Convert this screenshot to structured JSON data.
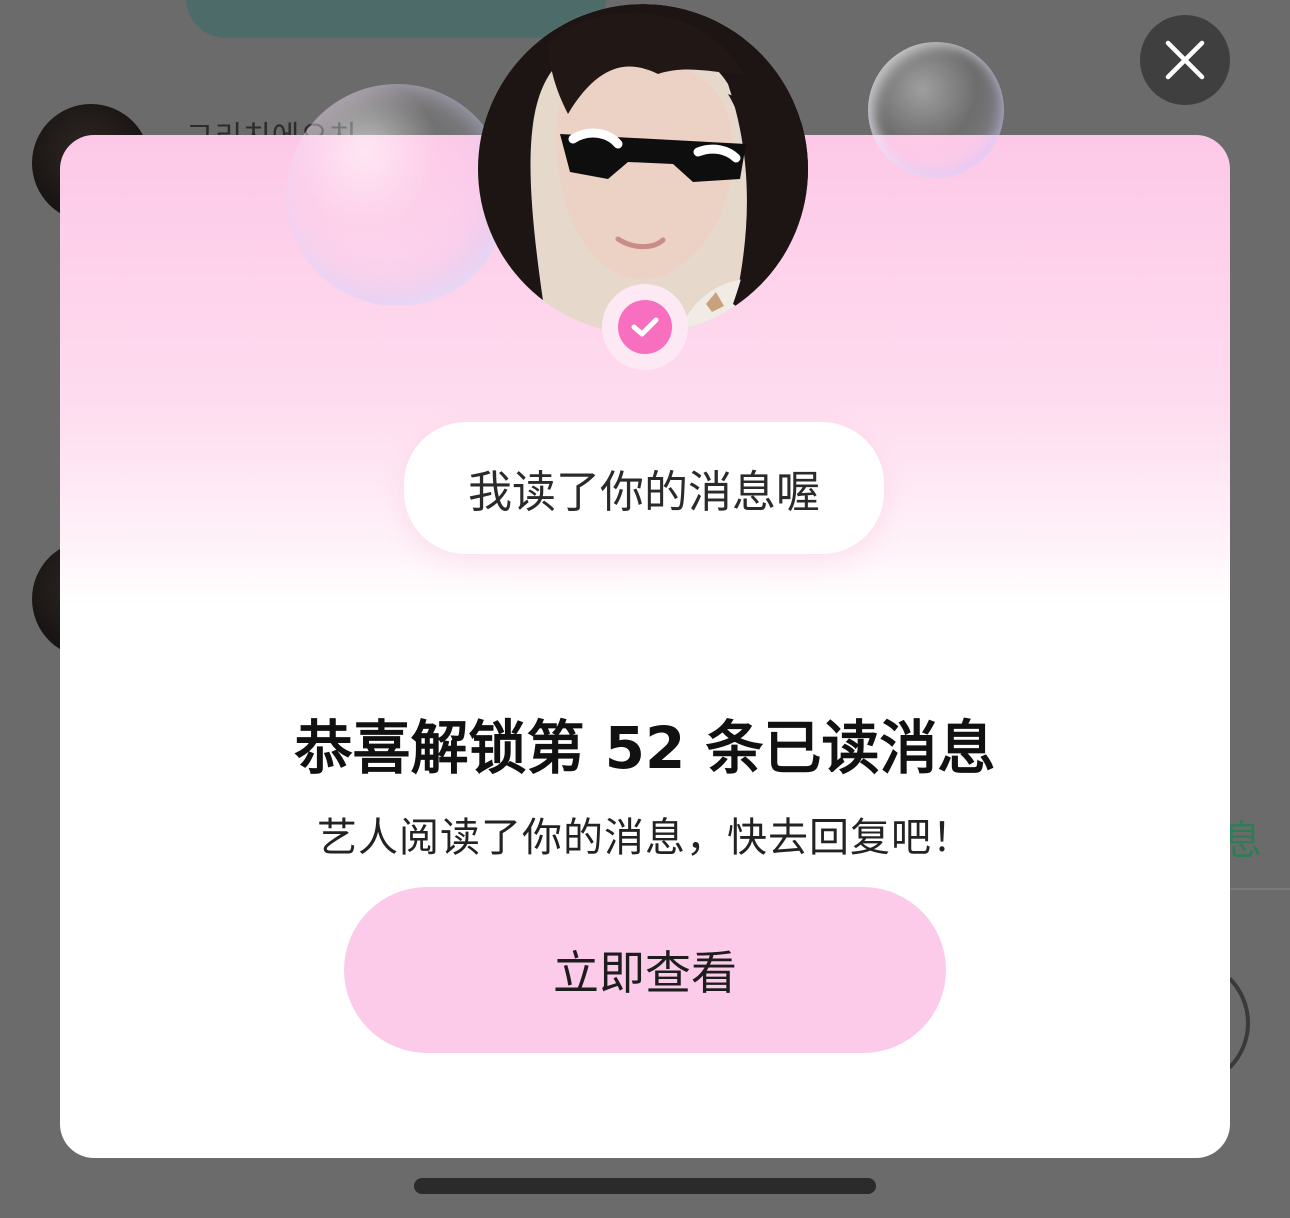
{
  "background": {
    "contact_name": "그리치에오치",
    "side_text": "息"
  },
  "modal": {
    "speech_bubble": "我读了你的消息喔",
    "headline": "恭喜解锁第 52 条已读消息",
    "read_count": 52,
    "subline": "艺人阅读了你的消息，快去回复吧！",
    "cta_label": "立即查看"
  },
  "icons": {
    "close": "close-icon",
    "verified": "check-badge-icon"
  },
  "colors": {
    "modal_gradient_top": "#fdc8e7",
    "cta_background": "#fccbea",
    "verified_badge": "#f96fc0",
    "overlay": "#6b6b6b"
  }
}
